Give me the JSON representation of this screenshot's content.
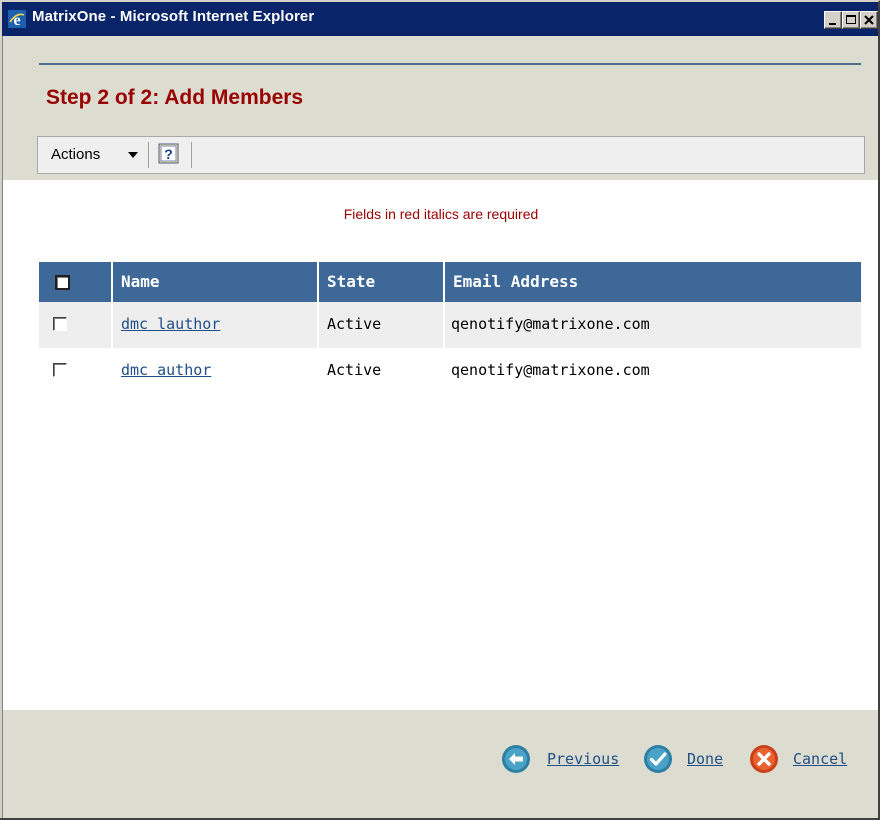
{
  "window": {
    "title": "MatrixOne - Microsoft Internet Explorer"
  },
  "page": {
    "title": "Step 2 of 2: Add Members",
    "required_note": "Fields in red italics are required"
  },
  "toolbar": {
    "actions_label": "Actions"
  },
  "table": {
    "headers": {
      "name": "Name",
      "state": "State",
      "email": "Email Address"
    },
    "rows": [
      {
        "name": "dmc lauthor",
        "state": "Active",
        "email": "qenotify@matrixone.com"
      },
      {
        "name": "dmc author",
        "state": "Active",
        "email": "qenotify@matrixone.com"
      }
    ]
  },
  "footer": {
    "previous_label": "Previous",
    "done_label": "Done",
    "cancel_label": "Cancel"
  },
  "colors": {
    "title_red": "#990000",
    "header_blue": "#3d6898",
    "link_blue": "#1f4f86",
    "titlebar_navy": "#0a246a",
    "panel_beige": "#dddcd0"
  },
  "icons": {
    "app": "ie-icon",
    "minimize": "minimize-icon",
    "maximize": "maximize-icon",
    "close": "close-icon",
    "actions_caret": "caret-down-icon",
    "help": "help-icon",
    "previous": "arrow-left-circle-icon",
    "done": "checkmark-circle-icon",
    "cancel": "x-circle-icon"
  }
}
